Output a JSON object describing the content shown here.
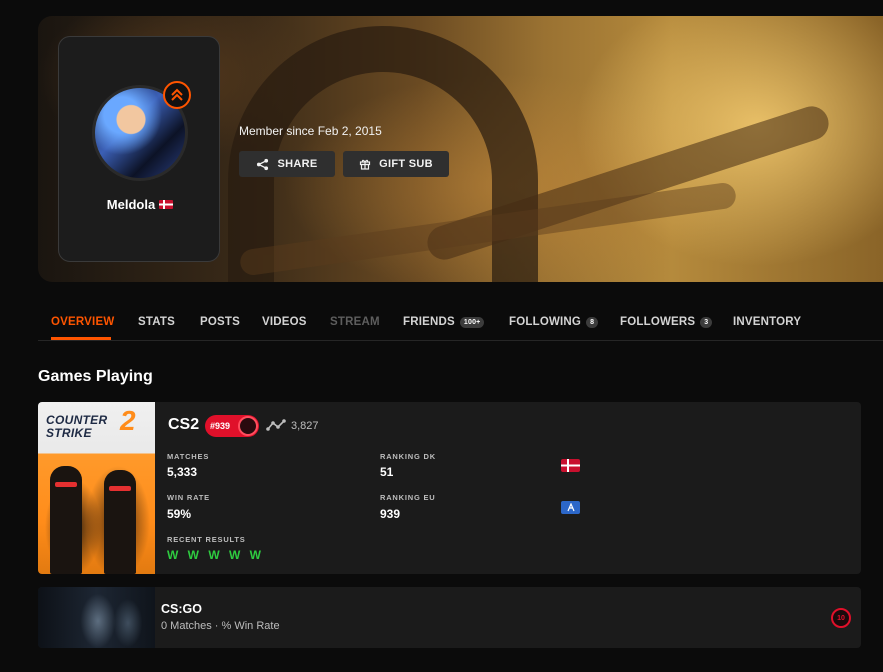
{
  "profile": {
    "username": "Meldola",
    "country": "DK",
    "member_since": "Member since Feb 2, 2015",
    "share_label": "SHARE",
    "gift_label": "GIFT SUB"
  },
  "tabs": [
    {
      "label": "OVERVIEW",
      "active": true
    },
    {
      "label": "STATS"
    },
    {
      "label": "POSTS"
    },
    {
      "label": "VIDEOS"
    },
    {
      "label": "STREAM",
      "disabled": true
    },
    {
      "label": "FRIENDS",
      "count": "100+"
    },
    {
      "label": "FOLLOWING",
      "count": "8"
    },
    {
      "label": "FOLLOWERS",
      "count": "3"
    },
    {
      "label": "INVENTORY"
    }
  ],
  "games_section": {
    "title": "Games Playing"
  },
  "cs2": {
    "cover_title": "COUNTER STRIKE",
    "cover_number": "2",
    "name": "CS2",
    "rank": "#939",
    "elo": "3,827",
    "matches_label": "MATCHES",
    "matches_value": "5,333",
    "win_rate_label": "WIN RATE",
    "win_rate_value": "59%",
    "ranking_dk_label": "RANKING DK",
    "ranking_dk_value": "51",
    "ranking_eu_label": "RANKING EU",
    "ranking_eu_value": "939",
    "recent_results_label": "RECENT RESULTS",
    "recent_results": "W W W W W"
  },
  "csgo": {
    "name": "CS:GO",
    "sub": "0 Matches · % Win Rate",
    "level": "10"
  },
  "colors": {
    "accent": "#ff5500",
    "win": "#2ecc40",
    "rank": "#e0102a"
  }
}
